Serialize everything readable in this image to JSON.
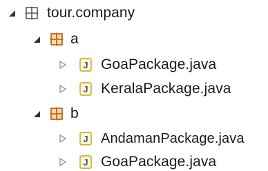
{
  "tree": {
    "root": {
      "label": "tour.company",
      "expanded": true,
      "icon": "package-icon",
      "children": [
        {
          "label": "a",
          "expanded": true,
          "icon": "package-icon",
          "files": [
            {
              "label": "GoaPackage.java",
              "icon": "java-file-icon"
            },
            {
              "label": "KeralaPackage.java",
              "icon": "java-file-icon"
            }
          ]
        },
        {
          "label": "b",
          "expanded": true,
          "icon": "package-icon",
          "files": [
            {
              "label": "AndamanPackage.java",
              "icon": "java-file-icon"
            },
            {
              "label": "GoaPackage.java",
              "icon": "java-file-icon"
            }
          ]
        }
      ]
    },
    "colors": {
      "package_root": "#5a5a5a",
      "package_child": "#c0651f",
      "java_icon_border": "#c79f1a",
      "java_icon_fill": "#fff7d6",
      "java_icon_letter": "#2a5a9a",
      "twisty_expanded": "#333333",
      "twisty_collapsed": "#9a9a9a"
    }
  }
}
